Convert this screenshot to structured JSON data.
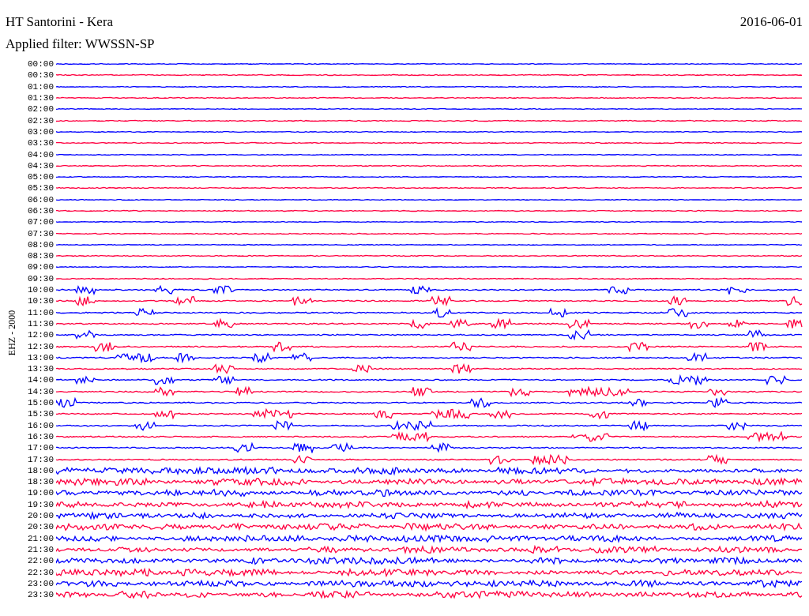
{
  "header": {
    "title": "HT Santorini - Kera",
    "date": "2016-06-01",
    "filter": "Applied filter: WWSSN-SP"
  },
  "channel_label": "EHZ - 2000",
  "traces": [
    {
      "label": "00:00",
      "color": "#0000ff"
    },
    {
      "label": "00:30",
      "color": "#ff0040"
    },
    {
      "label": "01:00",
      "color": "#0000ff"
    },
    {
      "label": "01:30",
      "color": "#ff0040"
    },
    {
      "label": "02:00",
      "color": "#0000ff"
    },
    {
      "label": "02:30",
      "color": "#ff0040"
    },
    {
      "label": "03:00",
      "color": "#0000ff"
    },
    {
      "label": "03:30",
      "color": "#ff0040"
    },
    {
      "label": "04:00",
      "color": "#0000ff"
    },
    {
      "label": "04:30",
      "color": "#ff0040"
    },
    {
      "label": "05:00",
      "color": "#0000ff"
    },
    {
      "label": "05:30",
      "color": "#ff0040"
    },
    {
      "label": "06:00",
      "color": "#0000ff"
    },
    {
      "label": "06:30",
      "color": "#ff0040"
    },
    {
      "label": "07:00",
      "color": "#0000ff"
    },
    {
      "label": "07:30",
      "color": "#ff0040"
    },
    {
      "label": "08:00",
      "color": "#0000ff"
    },
    {
      "label": "08:30",
      "color": "#ff0040"
    },
    {
      "label": "09:00",
      "color": "#0000ff"
    },
    {
      "label": "09:30",
      "color": "#ff0040"
    },
    {
      "label": "10:00",
      "color": "#0000ff"
    },
    {
      "label": "10:30",
      "color": "#ff0040"
    },
    {
      "label": "11:00",
      "color": "#0000ff"
    },
    {
      "label": "11:30",
      "color": "#ff0040"
    },
    {
      "label": "12:00",
      "color": "#0000ff"
    },
    {
      "label": "12:30",
      "color": "#ff0040"
    },
    {
      "label": "13:00",
      "color": "#0000ff"
    },
    {
      "label": "13:30",
      "color": "#ff0040"
    },
    {
      "label": "14:00",
      "color": "#0000ff"
    },
    {
      "label": "14:30",
      "color": "#ff0040"
    },
    {
      "label": "15:00",
      "color": "#0000ff"
    },
    {
      "label": "15:30",
      "color": "#ff0040"
    },
    {
      "label": "16:00",
      "color": "#0000ff"
    },
    {
      "label": "16:30",
      "color": "#ff0040"
    },
    {
      "label": "17:00",
      "color": "#0000ff"
    },
    {
      "label": "17:30",
      "color": "#ff0040"
    },
    {
      "label": "18:00",
      "color": "#0000ff"
    },
    {
      "label": "18:30",
      "color": "#ff0040"
    },
    {
      "label": "19:00",
      "color": "#0000ff"
    },
    {
      "label": "19:30",
      "color": "#ff0040"
    },
    {
      "label": "20:00",
      "color": "#0000ff"
    },
    {
      "label": "20:30",
      "color": "#ff0040"
    },
    {
      "label": "21:00",
      "color": "#0000ff"
    },
    {
      "label": "21:30",
      "color": "#ff0040"
    },
    {
      "label": "22:00",
      "color": "#0000ff"
    },
    {
      "label": "22:30",
      "color": "#ff0040"
    },
    {
      "label": "23:00",
      "color": "#0000ff"
    },
    {
      "label": "23:30",
      "color": "#ff0040"
    }
  ]
}
